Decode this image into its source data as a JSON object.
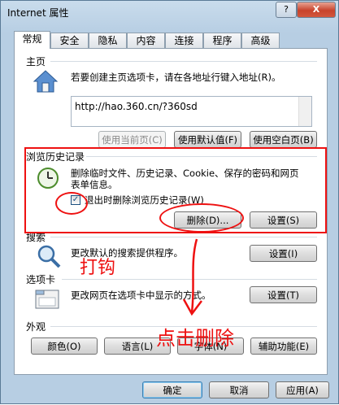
{
  "window": {
    "title": "Internet 属性",
    "help": "?",
    "close": "X"
  },
  "tabs": [
    "常规",
    "安全",
    "隐私",
    "内容",
    "连接",
    "程序",
    "高级"
  ],
  "homepage": {
    "label": "主页",
    "desc": "若要创建主页选项卡，请在各地址行键入地址(R)。",
    "url": "http://hao.360.cn/?360sd",
    "buttons": {
      "use_current": "使用当前页(C)",
      "use_default": "使用默认值(F)",
      "use_blank": "使用空白页(B)"
    }
  },
  "history": {
    "label": "浏览历史记录",
    "desc1": "删除临时文件、历史记录、Cookie、保存的密码和网页",
    "desc2": "表单信息。",
    "checkbox_label": "退出时删除浏览历史记录(W)",
    "checkbox_checked": true,
    "buttons": {
      "delete": "删除(D)...",
      "settings": "设置(S)"
    }
  },
  "search": {
    "label": "搜索",
    "desc": "更改默认的搜索提供程序。",
    "settings": "设置(I)"
  },
  "tabs_section": {
    "label": "选项卡",
    "desc": "更改网页在选项卡中显示的方式。",
    "settings": "设置(T)"
  },
  "appearance": {
    "label": "外观",
    "buttons": {
      "colors": "颜色(O)",
      "languages": "语言(L)",
      "fonts": "字体(N)",
      "accessibility": "辅助功能(E)"
    }
  },
  "footer": {
    "ok": "确定",
    "cancel": "取消",
    "apply": "应用(A)"
  },
  "annotations": {
    "check_note": "打钩",
    "click_delete_note": "点击删除"
  },
  "colors": {
    "annotation": "#e11111",
    "close_button": "#c8432b"
  }
}
